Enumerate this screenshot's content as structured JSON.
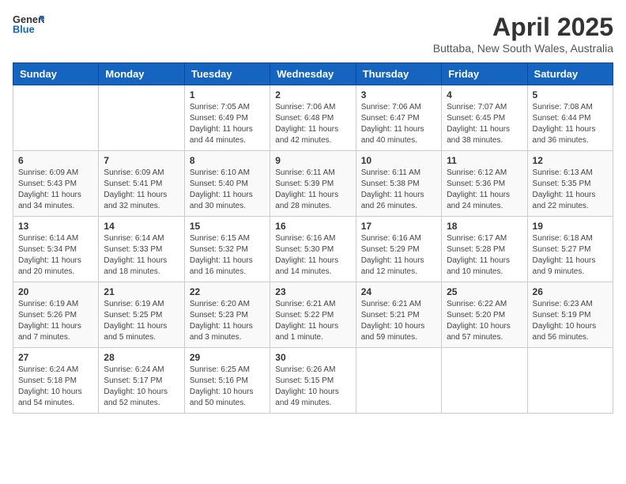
{
  "header": {
    "logo_general": "General",
    "logo_blue": "Blue",
    "month_year": "April 2025",
    "location": "Buttaba, New South Wales, Australia"
  },
  "days_of_week": [
    "Sunday",
    "Monday",
    "Tuesday",
    "Wednesday",
    "Thursday",
    "Friday",
    "Saturday"
  ],
  "weeks": [
    [
      {
        "day": "",
        "info": ""
      },
      {
        "day": "",
        "info": ""
      },
      {
        "day": "1",
        "info": "Sunrise: 7:05 AM\nSunset: 6:49 PM\nDaylight: 11 hours and 44 minutes."
      },
      {
        "day": "2",
        "info": "Sunrise: 7:06 AM\nSunset: 6:48 PM\nDaylight: 11 hours and 42 minutes."
      },
      {
        "day": "3",
        "info": "Sunrise: 7:06 AM\nSunset: 6:47 PM\nDaylight: 11 hours and 40 minutes."
      },
      {
        "day": "4",
        "info": "Sunrise: 7:07 AM\nSunset: 6:45 PM\nDaylight: 11 hours and 38 minutes."
      },
      {
        "day": "5",
        "info": "Sunrise: 7:08 AM\nSunset: 6:44 PM\nDaylight: 11 hours and 36 minutes."
      }
    ],
    [
      {
        "day": "6",
        "info": "Sunrise: 6:09 AM\nSunset: 5:43 PM\nDaylight: 11 hours and 34 minutes."
      },
      {
        "day": "7",
        "info": "Sunrise: 6:09 AM\nSunset: 5:41 PM\nDaylight: 11 hours and 32 minutes."
      },
      {
        "day": "8",
        "info": "Sunrise: 6:10 AM\nSunset: 5:40 PM\nDaylight: 11 hours and 30 minutes."
      },
      {
        "day": "9",
        "info": "Sunrise: 6:11 AM\nSunset: 5:39 PM\nDaylight: 11 hours and 28 minutes."
      },
      {
        "day": "10",
        "info": "Sunrise: 6:11 AM\nSunset: 5:38 PM\nDaylight: 11 hours and 26 minutes."
      },
      {
        "day": "11",
        "info": "Sunrise: 6:12 AM\nSunset: 5:36 PM\nDaylight: 11 hours and 24 minutes."
      },
      {
        "day": "12",
        "info": "Sunrise: 6:13 AM\nSunset: 5:35 PM\nDaylight: 11 hours and 22 minutes."
      }
    ],
    [
      {
        "day": "13",
        "info": "Sunrise: 6:14 AM\nSunset: 5:34 PM\nDaylight: 11 hours and 20 minutes."
      },
      {
        "day": "14",
        "info": "Sunrise: 6:14 AM\nSunset: 5:33 PM\nDaylight: 11 hours and 18 minutes."
      },
      {
        "day": "15",
        "info": "Sunrise: 6:15 AM\nSunset: 5:32 PM\nDaylight: 11 hours and 16 minutes."
      },
      {
        "day": "16",
        "info": "Sunrise: 6:16 AM\nSunset: 5:30 PM\nDaylight: 11 hours and 14 minutes."
      },
      {
        "day": "17",
        "info": "Sunrise: 6:16 AM\nSunset: 5:29 PM\nDaylight: 11 hours and 12 minutes."
      },
      {
        "day": "18",
        "info": "Sunrise: 6:17 AM\nSunset: 5:28 PM\nDaylight: 11 hours and 10 minutes."
      },
      {
        "day": "19",
        "info": "Sunrise: 6:18 AM\nSunset: 5:27 PM\nDaylight: 11 hours and 9 minutes."
      }
    ],
    [
      {
        "day": "20",
        "info": "Sunrise: 6:19 AM\nSunset: 5:26 PM\nDaylight: 11 hours and 7 minutes."
      },
      {
        "day": "21",
        "info": "Sunrise: 6:19 AM\nSunset: 5:25 PM\nDaylight: 11 hours and 5 minutes."
      },
      {
        "day": "22",
        "info": "Sunrise: 6:20 AM\nSunset: 5:23 PM\nDaylight: 11 hours and 3 minutes."
      },
      {
        "day": "23",
        "info": "Sunrise: 6:21 AM\nSunset: 5:22 PM\nDaylight: 11 hours and 1 minute."
      },
      {
        "day": "24",
        "info": "Sunrise: 6:21 AM\nSunset: 5:21 PM\nDaylight: 10 hours and 59 minutes."
      },
      {
        "day": "25",
        "info": "Sunrise: 6:22 AM\nSunset: 5:20 PM\nDaylight: 10 hours and 57 minutes."
      },
      {
        "day": "26",
        "info": "Sunrise: 6:23 AM\nSunset: 5:19 PM\nDaylight: 10 hours and 56 minutes."
      }
    ],
    [
      {
        "day": "27",
        "info": "Sunrise: 6:24 AM\nSunset: 5:18 PM\nDaylight: 10 hours and 54 minutes."
      },
      {
        "day": "28",
        "info": "Sunrise: 6:24 AM\nSunset: 5:17 PM\nDaylight: 10 hours and 52 minutes."
      },
      {
        "day": "29",
        "info": "Sunrise: 6:25 AM\nSunset: 5:16 PM\nDaylight: 10 hours and 50 minutes."
      },
      {
        "day": "30",
        "info": "Sunrise: 6:26 AM\nSunset: 5:15 PM\nDaylight: 10 hours and 49 minutes."
      },
      {
        "day": "",
        "info": ""
      },
      {
        "day": "",
        "info": ""
      },
      {
        "day": "",
        "info": ""
      }
    ]
  ]
}
